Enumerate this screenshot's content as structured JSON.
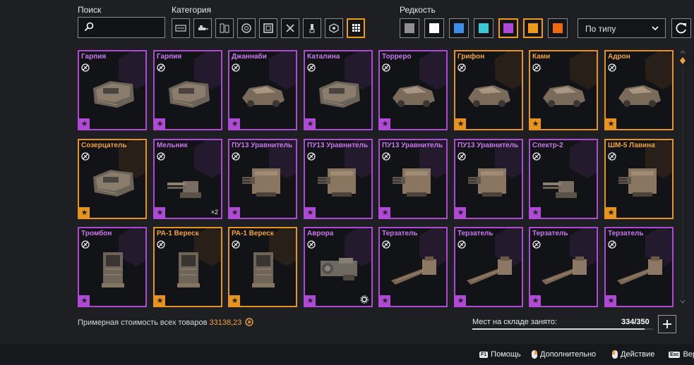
{
  "filters": {
    "search_label": "Поиск",
    "search_value": "",
    "category_label": "Категория",
    "categories": [
      {
        "icon": "cabin-icon",
        "active": false
      },
      {
        "icon": "weapon-icon",
        "active": false
      },
      {
        "icon": "module-icon",
        "active": false
      },
      {
        "icon": "wheel-icon",
        "active": false
      },
      {
        "icon": "frame-icon",
        "active": false
      },
      {
        "icon": "tool-icon",
        "active": false
      },
      {
        "icon": "paint-icon",
        "active": false
      },
      {
        "icon": "sticker-icon",
        "active": false
      },
      {
        "icon": "grid-all-icon",
        "active": true
      }
    ],
    "rarity_label": "Редкость",
    "rarities": [
      {
        "name": "gray",
        "color": "#8f8f8f",
        "active": false
      },
      {
        "name": "white",
        "color": "#ffffff",
        "active": false
      },
      {
        "name": "blue",
        "color": "#3c8fe8",
        "active": false
      },
      {
        "name": "cyan",
        "color": "#3cc8d0",
        "active": false
      },
      {
        "name": "purple",
        "color": "#b04ad6",
        "active": true
      },
      {
        "name": "orange",
        "color": "#f09a1b",
        "active": true
      },
      {
        "name": "red-orange",
        "color": "#f06a10",
        "active": false
      }
    ],
    "sort_value": "По типу"
  },
  "items": [
    {
      "name": "Гарпия",
      "rarity": "epic",
      "art": "cabin"
    },
    {
      "name": "Гарпия",
      "rarity": "epic",
      "art": "cabin"
    },
    {
      "name": "Джаннаби",
      "rarity": "epic",
      "art": "car"
    },
    {
      "name": "Каталина",
      "rarity": "epic",
      "art": "cabin"
    },
    {
      "name": "Торреро",
      "rarity": "epic",
      "art": "car"
    },
    {
      "name": "Грифон",
      "rarity": "legend",
      "art": "car"
    },
    {
      "name": "Ками",
      "rarity": "legend",
      "art": "car"
    },
    {
      "name": "Адрон",
      "rarity": "legend",
      "art": "car"
    },
    {
      "name": "Созерцатель",
      "rarity": "legend",
      "art": "cabin"
    },
    {
      "name": "Мельник",
      "rarity": "epic",
      "art": "turret",
      "qty": "×2"
    },
    {
      "name": "ПУ13 Уравнитель",
      "rarity": "epic",
      "art": "launcher"
    },
    {
      "name": "ПУ13 Уравнитель",
      "rarity": "epic",
      "art": "launcher"
    },
    {
      "name": "ПУ13 Уравнитель",
      "rarity": "epic",
      "art": "launcher"
    },
    {
      "name": "ПУ13 Уравнитель",
      "rarity": "epic",
      "art": "launcher"
    },
    {
      "name": "Спектр-2",
      "rarity": "epic",
      "art": "turret"
    },
    {
      "name": "ШМ-5 Лавина",
      "rarity": "legend",
      "art": "launcher"
    },
    {
      "name": "Тромбон",
      "rarity": "epic",
      "art": "tower"
    },
    {
      "name": "РА-1 Вереск",
      "rarity": "legend",
      "art": "tower"
    },
    {
      "name": "РА-1 Вереск",
      "rarity": "legend",
      "art": "tower"
    },
    {
      "name": "Аврора",
      "rarity": "epic",
      "art": "engine",
      "gear": true
    },
    {
      "name": "Терзатель",
      "rarity": "epic",
      "art": "rail"
    },
    {
      "name": "Терзатель",
      "rarity": "epic",
      "art": "rail"
    },
    {
      "name": "Терзатель",
      "rarity": "epic",
      "art": "rail"
    },
    {
      "name": "Терзатель",
      "rarity": "epic",
      "art": "rail"
    }
  ],
  "summary": {
    "total_label": "Примерная стоимость всех товаров",
    "total_value": "33138,23",
    "storage_label": "Мест на складе занято:",
    "storage_value": "334/350",
    "storage_fraction": 0.954
  },
  "footer": {
    "help": {
      "key": "F1",
      "label": "Помощь"
    },
    "more": {
      "label": "Дополнительно"
    },
    "action": {
      "label": "Действие"
    },
    "back": {
      "key": "Esc",
      "label": "Вер"
    }
  }
}
